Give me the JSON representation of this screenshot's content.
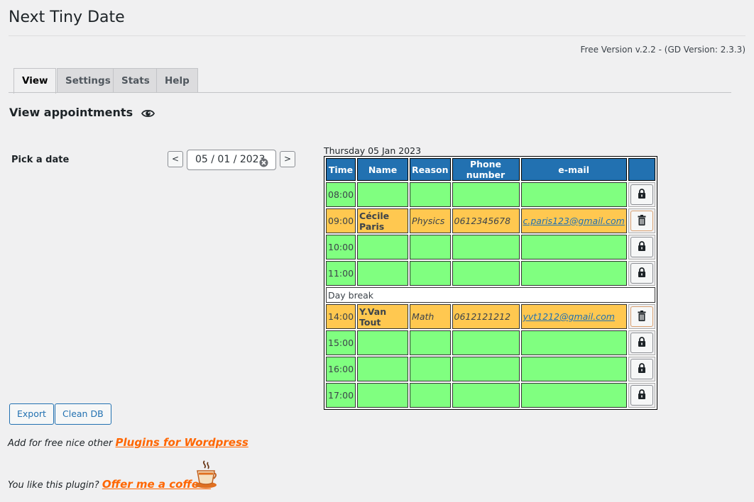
{
  "header": {
    "title": "Next Tiny Date",
    "version": "Free Version v.2.2 - (GD Version: 2.3.3)"
  },
  "tabs": [
    {
      "label": "View",
      "active": true
    },
    {
      "label": "Settings",
      "active": false
    },
    {
      "label": "Stats",
      "active": false
    },
    {
      "label": "Help",
      "active": false
    }
  ],
  "section": {
    "title": "View appointments",
    "icon": "eye-icon"
  },
  "date_picker": {
    "label": "Pick a date",
    "prev_label": "<",
    "next_label": ">",
    "value": "05 / 01 / 2023"
  },
  "calendar": {
    "caption": "Thursday 05 Jan 2023",
    "headers": [
      "Time",
      "Name",
      "Reason",
      "Phone number",
      "e-mail",
      ""
    ],
    "day_break_label": "Day break",
    "rows": [
      {
        "time": "08:00",
        "name": "",
        "reason": "",
        "phone": "",
        "email": "",
        "status": "free",
        "action": "lock-icon"
      },
      {
        "time": "09:00",
        "name": "Cécile Paris",
        "reason": "Physics",
        "phone": "0612345678",
        "email": "c.paris123@gmail.com",
        "status": "booked",
        "action": "trash-icon"
      },
      {
        "time": "10:00",
        "name": "",
        "reason": "",
        "phone": "",
        "email": "",
        "status": "free",
        "action": "lock-icon"
      },
      {
        "time": "11:00",
        "name": "",
        "reason": "",
        "phone": "",
        "email": "",
        "status": "free",
        "action": "lock-icon"
      },
      {
        "time": "14:00",
        "name": "Y.Van Tout",
        "reason": "Math",
        "phone": "0612121212",
        "email": "yvt1212@gmail.com",
        "status": "booked",
        "action": "trash-icon"
      },
      {
        "time": "15:00",
        "name": "",
        "reason": "",
        "phone": "",
        "email": "",
        "status": "free",
        "action": "lock-icon"
      },
      {
        "time": "16:00",
        "name": "",
        "reason": "",
        "phone": "",
        "email": "",
        "status": "free",
        "action": "lock-icon"
      },
      {
        "time": "17:00",
        "name": "",
        "reason": "",
        "phone": "",
        "email": "",
        "status": "free",
        "action": "lock-icon"
      }
    ]
  },
  "actions": {
    "export_label": "Export",
    "clean_label": "Clean DB"
  },
  "promo": {
    "plugins_text": "Add for free nice other",
    "plugins_link": "Plugins for Wordpress",
    "coffee_text": "You like this plugin?",
    "coffee_link": "Offer me a coffee!"
  },
  "colors": {
    "header_blue": "#2271b1",
    "free_green": "#80ff80",
    "booked_orange": "#ffc850",
    "link_orange": "#ff6600"
  }
}
